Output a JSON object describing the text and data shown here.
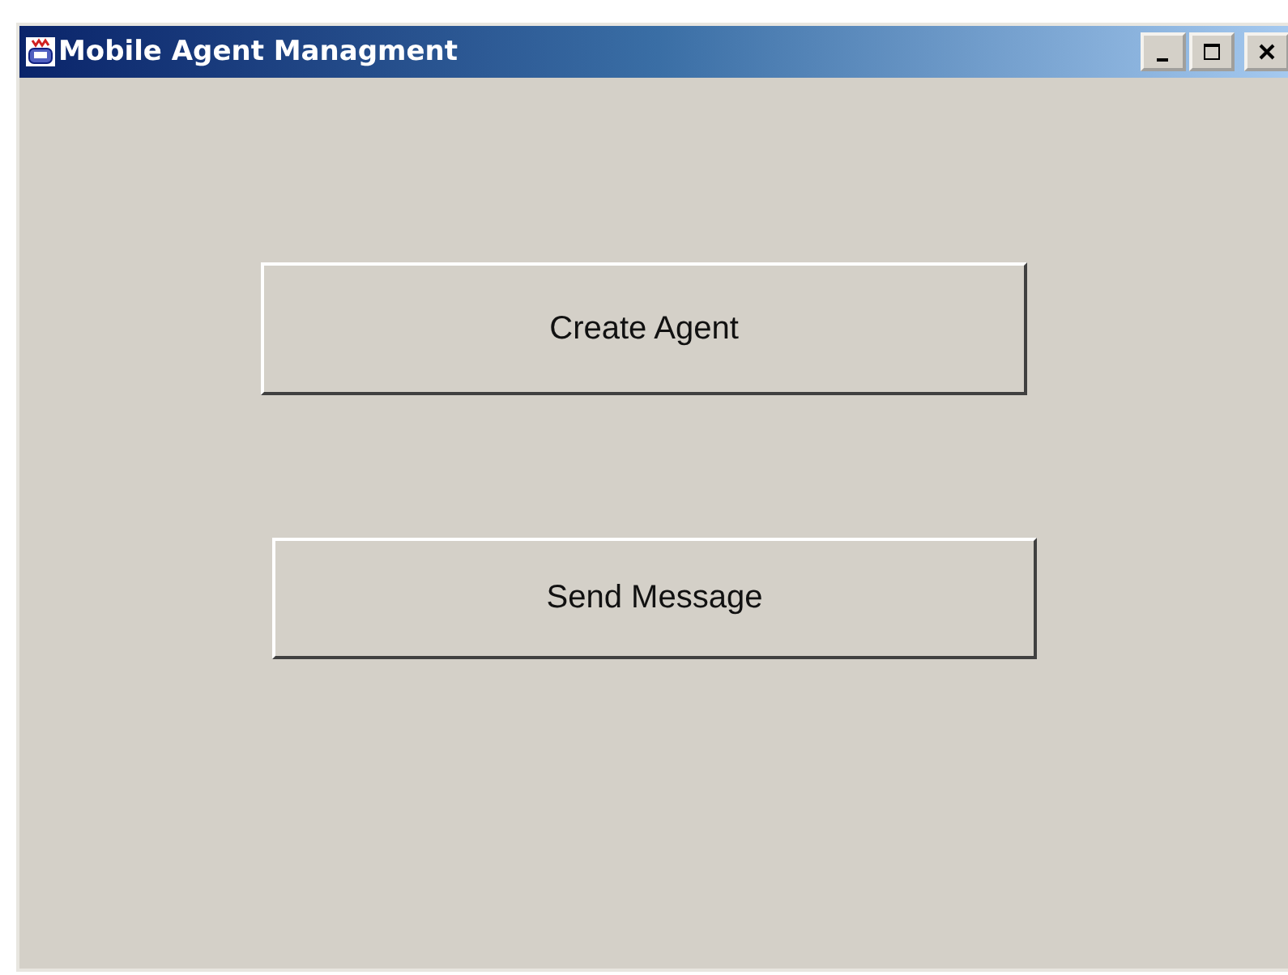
{
  "window": {
    "title": "Mobile Agent Managment"
  },
  "buttons": [
    {
      "label": "Create Agent"
    },
    {
      "label": "Send Message"
    }
  ]
}
